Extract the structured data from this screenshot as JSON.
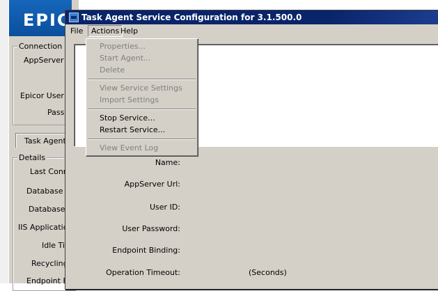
{
  "background_window": {
    "logo": "EPIC",
    "connection_group": {
      "title": "Connection Pr",
      "appserver_label": "AppServer N",
      "user_label": "Epicor User N",
      "password_label": "Pass"
    },
    "tab_label": "Task Agent",
    "details_group": {
      "title": "Details",
      "labels": [
        "Last Conn",
        "Database S",
        "Database I",
        "IIS Application",
        "Idle Tir",
        "Recycling",
        "Endpoint Bi"
      ]
    }
  },
  "dialog": {
    "title": "Task Agent Service Configuration for 3.1.500.0",
    "menu": {
      "file": "File",
      "actions": "Actions",
      "help": "Help"
    },
    "fields": {
      "name": "Name:",
      "appserver_url": "AppServer Url:",
      "user_id": "User ID:",
      "user_password": "User Password:",
      "endpoint_binding": "Endpoint Binding:",
      "operation_timeout": "Operation Timeout:",
      "timeout_unit": "(Seconds)"
    }
  },
  "actions_menu": {
    "properties": "Properties...",
    "start_agent": "Start Agent...",
    "delete": "Delete",
    "view_service_settings": "View Service Settings",
    "import_settings": "Import Settings",
    "stop_service": "Stop Service...",
    "restart_service": "Restart Service...",
    "view_event_log": "View Event Log"
  },
  "colors": {
    "title_bar": "#0a246a",
    "window_face": "#d4d0c8",
    "disabled_text": "#808080",
    "banner": "#1666bb"
  }
}
